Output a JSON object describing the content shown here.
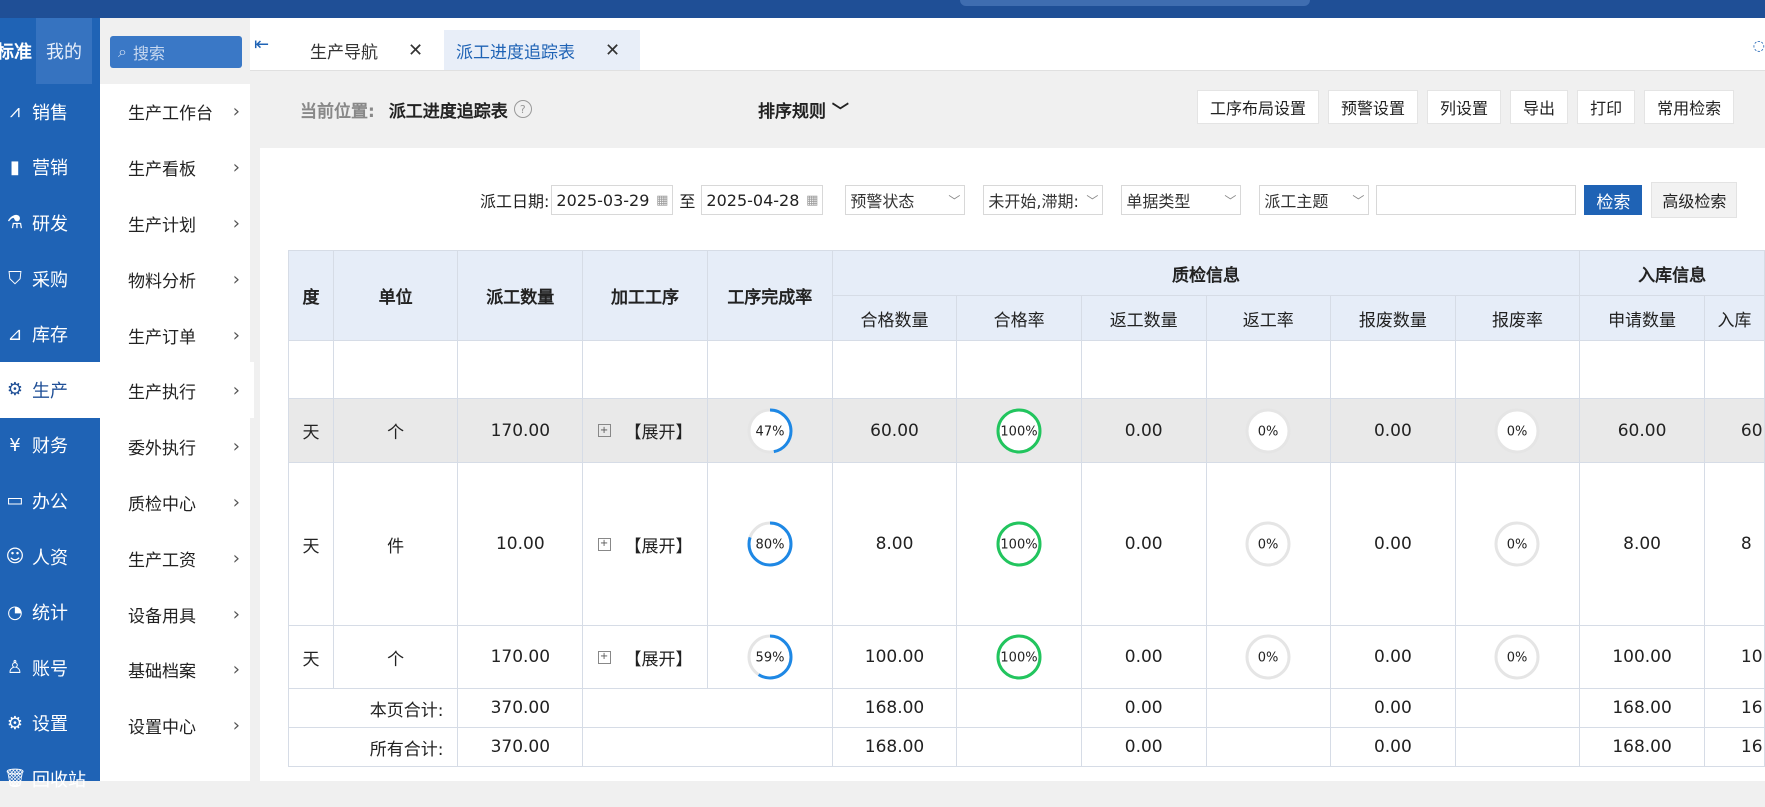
{
  "nav": {
    "tabs": [
      "标准",
      "我的"
    ],
    "search_placeholder": "搜索",
    "items": [
      {
        "label": "销售",
        "icon": "chart-icon"
      },
      {
        "label": "营销",
        "icon": "bar-chart-icon"
      },
      {
        "label": "研发",
        "icon": "flask-icon"
      },
      {
        "label": "采购",
        "icon": "basket-icon"
      },
      {
        "label": "库存",
        "icon": "line-chart-icon"
      },
      {
        "label": "生产",
        "icon": "factory-icon",
        "active": true
      },
      {
        "label": "财务",
        "icon": "yen-icon"
      },
      {
        "label": "办公",
        "icon": "briefcase-icon"
      },
      {
        "label": "人资",
        "icon": "person-icon"
      },
      {
        "label": "统计",
        "icon": "pie-icon"
      },
      {
        "label": "账号",
        "icon": "user-icon"
      },
      {
        "label": "设置",
        "icon": "gear-icon"
      },
      {
        "label": "回收站",
        "icon": "trash-icon"
      }
    ]
  },
  "subnav": {
    "items": [
      "生产工作台",
      "生产看板",
      "生产计划",
      "物料分析",
      "生产订单",
      "生产执行",
      "委外执行",
      "质检中心",
      "生产工资",
      "设备用具",
      "基础档案",
      "设置中心"
    ]
  },
  "tabs": [
    {
      "label": "生产导航"
    },
    {
      "label": "派工进度追踪表",
      "active": true
    }
  ],
  "breadcrumb": {
    "label": "当前位置:",
    "current": "派工进度追踪表"
  },
  "sort_label": "排序规则",
  "toolbar": [
    "工序布局设置",
    "预警设置",
    "列设置",
    "导出",
    "打印",
    "常用检索"
  ],
  "filters": {
    "date_label": "派工日期:",
    "date_from": "2025-03-29",
    "to_label": "至",
    "date_to": "2025-04-28",
    "warning_status": "预警状态",
    "progress_status": "未开始,滞期:",
    "doc_type": "单据类型",
    "subject": "派工主题",
    "keyword": "",
    "search_btn": "检索",
    "advanced_btn": "高级检索"
  },
  "table": {
    "headers": {
      "progress": "度",
      "unit": "单位",
      "qty": "派工数量",
      "process": "加工工序",
      "completion": "工序完成率",
      "qc_group": "质检信息",
      "qc_cols": [
        "合格数量",
        "合格率",
        "返工数量",
        "返工率",
        "报废数量",
        "报废率"
      ],
      "stock_group": "入库信息",
      "stock_cols": [
        "申请数量",
        "入库"
      ]
    },
    "rows": [
      {
        "progress": "天",
        "unit": "个",
        "qty": "170.00",
        "process": "【展开】",
        "completion": 47,
        "pass_qty": "60.00",
        "pass_rate": 100,
        "rework_qty": "0.00",
        "rework_rate": 0,
        "scrap_qty": "0.00",
        "scrap_rate": 0,
        "apply_qty": "60.00",
        "stock_qty": "60",
        "highlight": true
      },
      {
        "progress": "天",
        "unit": "件",
        "qty": "10.00",
        "process": "【展开】",
        "completion": 80,
        "pass_qty": "8.00",
        "pass_rate": 100,
        "rework_qty": "0.00",
        "rework_rate": 0,
        "scrap_qty": "0.00",
        "scrap_rate": 0,
        "apply_qty": "8.00",
        "stock_qty": "8"
      },
      {
        "progress": "天",
        "unit": "个",
        "qty": "170.00",
        "process": "【展开】",
        "completion": 59,
        "pass_qty": "100.00",
        "pass_rate": 100,
        "rework_qty": "0.00",
        "rework_rate": 0,
        "scrap_qty": "0.00",
        "scrap_rate": 0,
        "apply_qty": "100.00",
        "stock_qty": "10"
      }
    ],
    "page_total": {
      "label": "本页合计:",
      "qty": "370.00",
      "pass_qty": "168.00",
      "rework_qty": "0.00",
      "scrap_qty": "0.00",
      "apply_qty": "168.00",
      "stock_qty": "16"
    },
    "all_total": {
      "label": "所有合计:",
      "qty": "370.00",
      "pass_qty": "168.00",
      "rework_qty": "0.00",
      "scrap_qty": "0.00",
      "apply_qty": "168.00",
      "stock_qty": "16"
    }
  },
  "colors": {
    "ring_blue": "#1e88e5",
    "ring_green": "#22c55e",
    "ring_grey": "#e5e5e5",
    "total_red": "#d22222"
  }
}
